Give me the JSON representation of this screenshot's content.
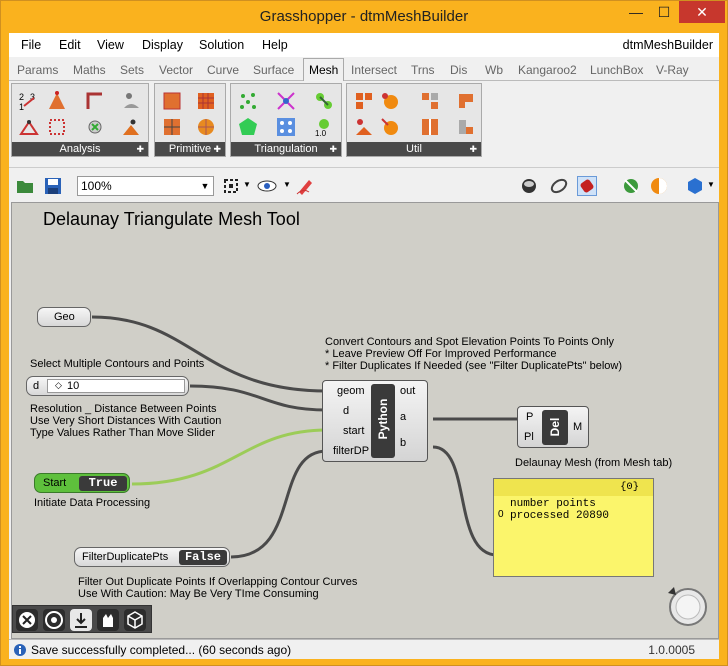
{
  "window": {
    "title": "Grasshopper - dtmMeshBuilder",
    "min_glyph": "—",
    "max_glyph": "☐",
    "close_glyph": "✕"
  },
  "menu": {
    "items": [
      "File",
      "Edit",
      "View",
      "Display",
      "Solution",
      "Help"
    ],
    "document_name": "dtmMeshBuilder"
  },
  "tabs": [
    "Params",
    "Maths",
    "Sets",
    "Vector",
    "Curve",
    "Surface",
    "Mesh",
    "Intersect",
    "Trns",
    "Dis",
    "Wb",
    "Kangaroo2",
    "LunchBox",
    "V-Ray"
  ],
  "active_tab": "Mesh",
  "ribbon_panels": [
    "Analysis",
    "Primitive",
    "Triangulation",
    "Util"
  ],
  "toolbar": {
    "zoom": "100%"
  },
  "canvas": {
    "heading": "Delaunay Triangulate Mesh Tool",
    "geo_label": "Geo",
    "contours_note": "Select Multiple Contours and Points",
    "slider": {
      "name": "d",
      "value": "10"
    },
    "resolution_note": "Resolution _ Distance Between Points\nUse Very Short Distances With Caution\nType Values Rather Than Move Slider",
    "start_toggle": {
      "name": "Start",
      "value": "True"
    },
    "start_note": "Initiate Data Processing",
    "filter_toggle": {
      "name": "FilterDuplicatePts",
      "value": "False"
    },
    "filter_note": "Filter Out Duplicate Points If Overlapping Contour Curves\nUse With Caution: May Be Very TIme Consuming",
    "python_note": "Convert Contours and Spot Elevation Points To Points Only\n* Leave Preview Off For Improved Performance\n* Filter Duplicates If Needed (see \"Filter DuplicatePts\" below)",
    "python": {
      "nick": "Python",
      "inputs": [
        "geom",
        "d",
        "start",
        "filterDP"
      ],
      "outputs": [
        "out",
        "a",
        "b"
      ]
    },
    "delaunay": {
      "nick": "Del",
      "inputs": [
        "P",
        "Pl"
      ],
      "output": "M"
    },
    "delaunay_note": "Delaunay Mesh (from Mesh tab)",
    "panel": {
      "header": "{0}",
      "index": "0",
      "text": "number points\nprocessed 20890"
    }
  },
  "status": {
    "text": "Save successfully completed... (60 seconds ago)",
    "version": "1.0.0005"
  },
  "colors": {
    "window": "#fab21e",
    "close": "#c7372d",
    "canvas": "#d0cfc8",
    "panel": "#fbf56b",
    "toggle_green": "#5ec03c",
    "wire_green": "#9ccc58"
  }
}
